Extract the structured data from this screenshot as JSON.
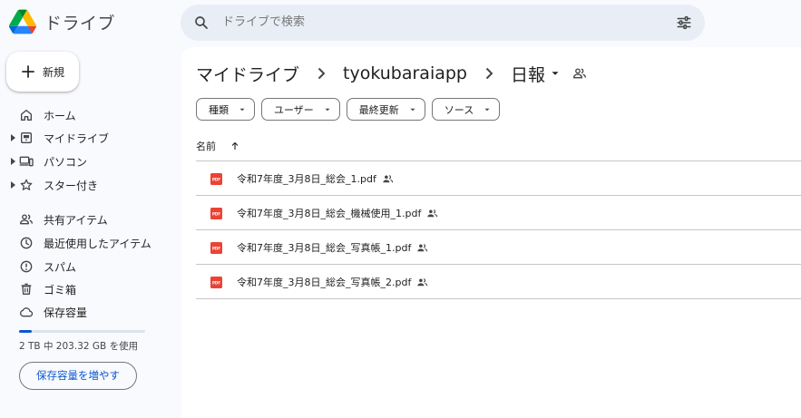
{
  "app": {
    "title": "ドライブ"
  },
  "search": {
    "placeholder": "ドライブで検索"
  },
  "sidebar": {
    "new_label": "新規",
    "items": [
      {
        "label": "ホーム",
        "icon": "home-icon"
      },
      {
        "label": "マイドライブ",
        "icon": "my-drive-icon"
      },
      {
        "label": "パソコン",
        "icon": "computers-icon"
      },
      {
        "label": "スター付き",
        "icon": "star-icon"
      },
      {
        "label": "共有アイテム",
        "icon": "shared-icon"
      },
      {
        "label": "最近使用したアイテム",
        "icon": "recent-icon"
      },
      {
        "label": "スパム",
        "icon": "spam-icon"
      },
      {
        "label": "ゴミ箱",
        "icon": "trash-icon"
      },
      {
        "label": "保存容量",
        "icon": "cloud-icon"
      }
    ],
    "storage": {
      "text": "2 TB 中 203.32 GB を使用",
      "used_fraction": 0.099,
      "button": "保存容量を増やす"
    }
  },
  "breadcrumb": [
    "マイドライブ",
    "tyokubaraiapp",
    "日報"
  ],
  "filters": [
    "種類",
    "ユーザー",
    "最終更新",
    "ソース"
  ],
  "list": {
    "column_name": "名前",
    "files": [
      {
        "name": "令和7年度_3月8日_総会_1.pdf",
        "shared": true
      },
      {
        "name": "令和7年度_3月8日_総会_機械使用_1.pdf",
        "shared": true
      },
      {
        "name": "令和7年度_3月8日_総会_写真帳_1.pdf",
        "shared": true
      },
      {
        "name": "令和7年度_3月8日_総会_写真帳_2.pdf",
        "shared": true
      }
    ]
  },
  "colors": {
    "accent": "#0b57d0",
    "pdf_red": "#ea4335"
  }
}
